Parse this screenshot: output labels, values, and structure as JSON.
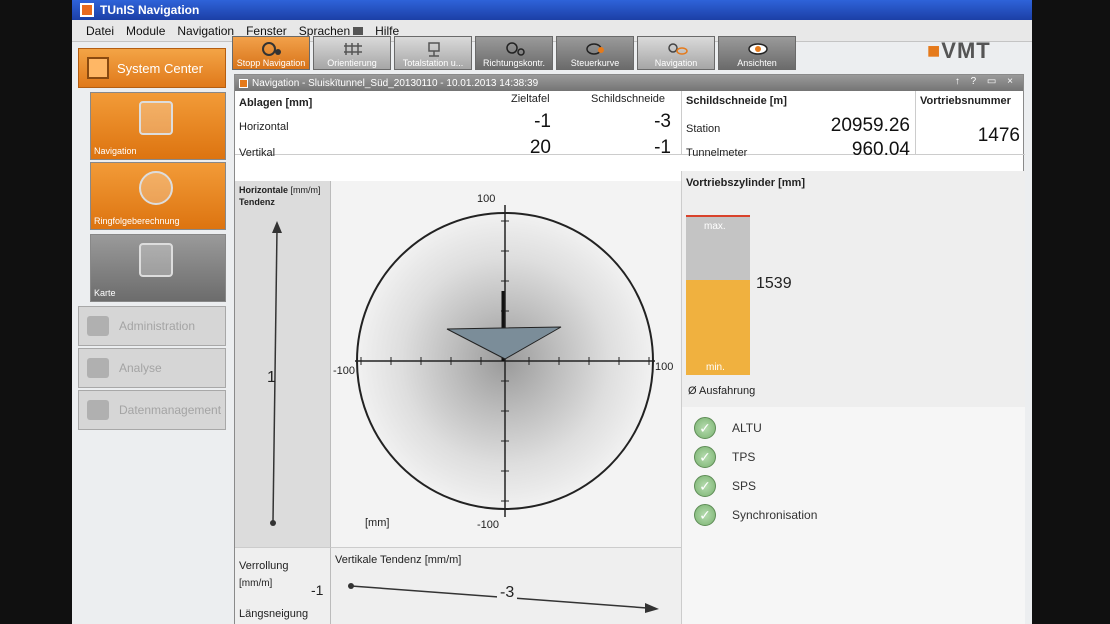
{
  "window": {
    "title": "TUnIS Navigation"
  },
  "menu": [
    "Datei",
    "Module",
    "Navigation",
    "Fenster",
    "Sprachen",
    "Hilfe"
  ],
  "sidebar": {
    "system_center": "System Center",
    "tiles": [
      {
        "label": "Navigation"
      },
      {
        "label": "Ringfolgeberechnung"
      },
      {
        "label": "Karte"
      }
    ],
    "buttons": [
      {
        "label": "Administration"
      },
      {
        "label": "Analyse"
      },
      {
        "label": "Datenmanagement"
      }
    ]
  },
  "toolbar": [
    {
      "label": "Stopp Navigation",
      "state": "active"
    },
    {
      "label": "Orientierung"
    },
    {
      "label": "Totalstation u..."
    },
    {
      "label": "Richtungskontr."
    },
    {
      "label": "Steuerkurve"
    },
    {
      "label": "Navigation"
    },
    {
      "label": "Ansichten"
    }
  ],
  "logo": "VMT",
  "nav_window": {
    "title": "Navigation - Sluiskïtunnel_Süd_20130110 - 10.01.2013 14:38:39",
    "controls": "↑ ? ▭ ×",
    "ablagen": {
      "label": "Ablagen [mm]",
      "col_zieltafel": "Zieltafel",
      "col_schildschneide": "Schildschneide",
      "row_horizontal": "Horizontal",
      "row_vertikal": "Vertikal",
      "h_zieltafel": "-1",
      "h_schildschneide": "-3",
      "v_zieltafel": "20",
      "v_schildschneide": "-1"
    },
    "schildschneide": {
      "label": "Schildschneide [m]",
      "station_label": "Station",
      "station_value": "20959.26",
      "tunnelmeter_label": "Tunnelmeter",
      "tunnelmeter_value": "960.04"
    },
    "vortriebsnummer": {
      "label": "Vortriebsnummer",
      "value": "1476"
    },
    "horizontal_tendenz": {
      "label1": "Horizontale",
      "unit": "[mm/m]",
      "label2": "Tendenz",
      "value": "1"
    },
    "polar": {
      "top": "100",
      "bottom": "-100",
      "left": "-100",
      "right": "100",
      "unit": "[mm]"
    },
    "zylinder": {
      "label": "Vortriebszylinder [mm]",
      "max": "max.",
      "min": "min.",
      "value": "1539",
      "fill_fraction": 0.6,
      "ausfahrung": "Ø Ausfahrung"
    },
    "status": [
      {
        "label": "ALTU"
      },
      {
        "label": "TPS"
      },
      {
        "label": "SPS"
      },
      {
        "label": "Synchronisation"
      }
    ],
    "verrollung": {
      "label": "Verrollung",
      "unit": "[mm/m]",
      "value": "-1"
    },
    "laengsneigung": {
      "label": "Längsneigung"
    },
    "vertikale_tendenz": {
      "label": "Vertikale Tendenz [mm/m]",
      "value": "-3"
    }
  },
  "colors": {
    "accent_orange": "#e57a1b",
    "title_blue": "#2a55c9",
    "cylinder_fill": "#f0b13f"
  }
}
